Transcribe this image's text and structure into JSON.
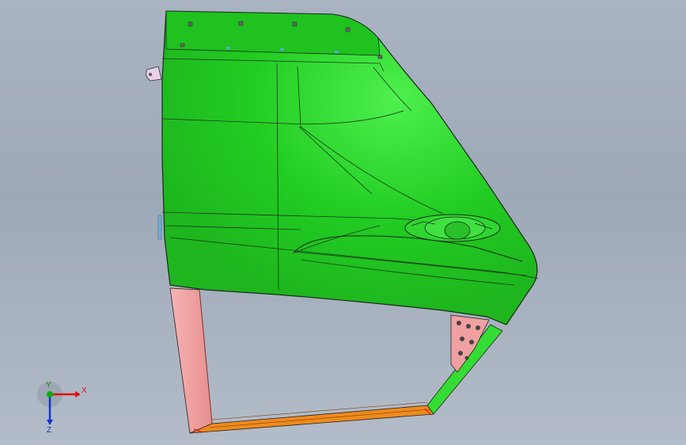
{
  "viewport": {
    "background_top": "#a9b3c1",
    "background_bottom": "#b3bcc8"
  },
  "model": {
    "panel_color": "#22cc22",
    "panel_highlight": "#44e644",
    "frame_pink": "#f4a0a0",
    "frame_orange": "#f08a1a",
    "frame_green": "#33dd33",
    "edge_color": "#1a2a1a"
  },
  "triad": {
    "x_label": "X",
    "y_label": "Y",
    "z_label": "Z",
    "x_color": "#dd1111",
    "y_color": "#11aa11",
    "z_color": "#1133cc"
  }
}
